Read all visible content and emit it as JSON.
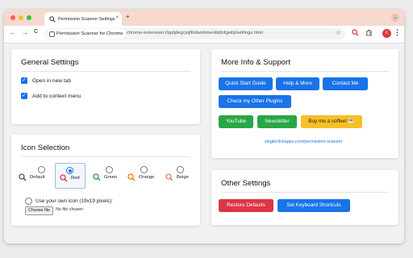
{
  "browser": {
    "tab_title": "Permission Scanner Settings",
    "new_tab": "+",
    "tab_close": "×",
    "tab_menu": "⌄",
    "chip_label": "Permission Scanner for Chrome",
    "url": "chrome-extension://pjdjdegcjnjfilofambmeobldnfgeibj/settings.html",
    "avatar_letter": "c",
    "back": "←",
    "forward": "→",
    "reload": "C",
    "star": "☆",
    "colors": {
      "tabstrip": "#f6d9cf",
      "close_dot": "#ff5f57",
      "min_dot": "#febc2e",
      "max_dot": "#28c840"
    }
  },
  "general": {
    "title": "General Settings",
    "options": [
      {
        "label": "Open in new tab",
        "checked": true
      },
      {
        "label": "Add to context menu",
        "checked": true
      }
    ]
  },
  "icon_selection": {
    "title": "Icon Selection",
    "options": [
      {
        "label": "Default",
        "color": "#555555",
        "selected": false
      },
      {
        "label": "Red",
        "color": "#e53935",
        "selected": true
      },
      {
        "label": "Green",
        "color": "#2e9e3e",
        "selected": false
      },
      {
        "label": "Orange",
        "color": "#f57c00",
        "selected": false
      },
      {
        "label": "Beige",
        "color": "#e0825a",
        "selected": false
      }
    ],
    "custom_label": "Use your own icon (19x19 pixels):",
    "choose_file": "Choose file",
    "no_file": "No file chosen"
  },
  "support": {
    "title": "More Info & Support",
    "buttons": {
      "quick_start": "Quick Start Guide",
      "help": "Help & More",
      "contact": "Contact Me",
      "plugins": "Check my Other Plugins",
      "youtube": "YouTube",
      "newsletter": "Newsletter",
      "coffee": "Buy me a coffee! ☕"
    },
    "link": "singleclickapps.com/permission-scanner"
  },
  "other": {
    "title": "Other Settings",
    "restore": "Restore Defaults",
    "shortcuts": "Set Keyboard Shortcuts"
  }
}
